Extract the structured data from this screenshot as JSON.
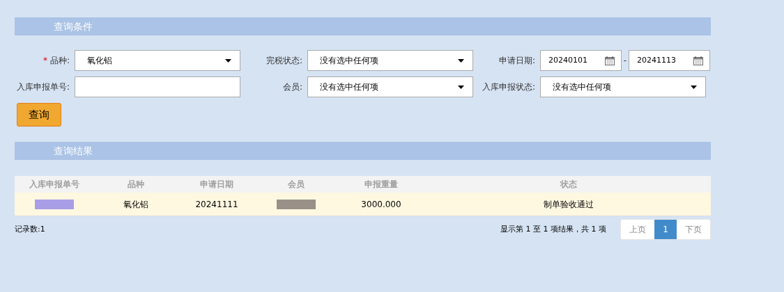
{
  "query_section": {
    "title": "查询条件"
  },
  "filters": [
    {
      "kind": "select",
      "required_mark": "*",
      "label": "品种:",
      "value": "氧化铝"
    },
    {
      "kind": "select",
      "label": "完税状态:",
      "value": "没有选中任何项"
    },
    {
      "kind": "daterange",
      "label": "申请日期:",
      "from": "20240101",
      "separator": "-",
      "to": "20241113"
    },
    {
      "kind": "text",
      "label": "入库申报单号:"
    },
    {
      "kind": "select",
      "label": "会员:",
      "value": "没有选中任何项"
    },
    {
      "kind": "select",
      "label": "入库申报状态:",
      "value": "没有选中任何项"
    }
  ],
  "query_button": "查询",
  "results_section": {
    "title": "查询结果"
  },
  "table": {
    "columns": [
      "入库申报单号",
      "品种",
      "申请日期",
      "会员",
      "申报重量",
      "状态"
    ],
    "rows": [
      {
        "cells": [
          {
            "kind": "redacted",
            "color": "#a89ee8"
          },
          {
            "kind": "text",
            "text": "氧化铝"
          },
          {
            "kind": "text",
            "text": "20241111"
          },
          {
            "kind": "redacted",
            "color": "#999088"
          },
          {
            "kind": "text",
            "text": "3000.000"
          },
          {
            "kind": "text",
            "text": "制单验收通过"
          }
        ]
      }
    ]
  },
  "record_count": "记录数:1",
  "pagination": {
    "info": "显示第 1 至 1 项结果，共 1 项",
    "buttons": [
      {
        "label": "上页",
        "selected": false
      },
      {
        "label": "1",
        "selected": true
      },
      {
        "label": "下页",
        "selected": false
      }
    ]
  }
}
